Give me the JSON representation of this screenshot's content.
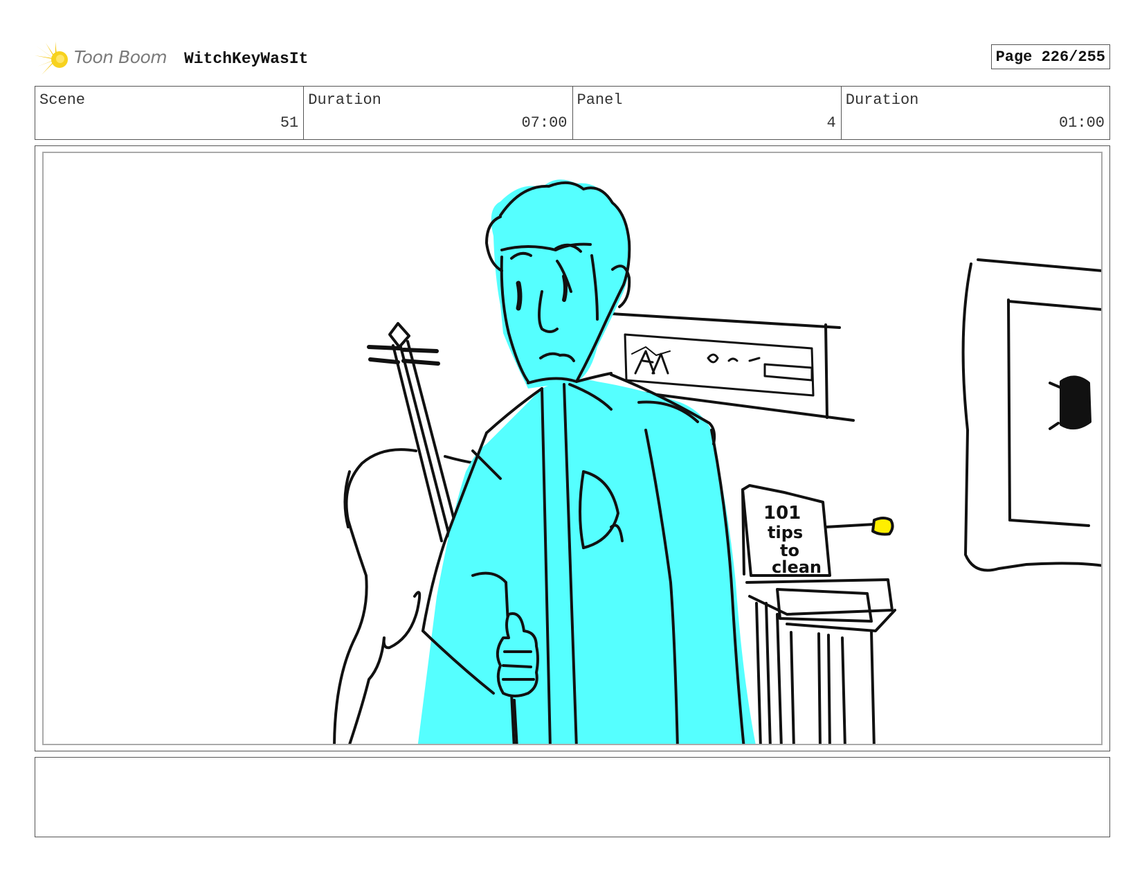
{
  "header": {
    "logo_text": "Toon Boom",
    "project_title": "WitchKeyWasIt",
    "page_label": "Page 226/255"
  },
  "info": {
    "scene_label": "Scene",
    "scene_value": "51",
    "scene_duration_label": "Duration",
    "scene_duration_value": "07:00",
    "panel_label": "Panel",
    "panel_value": "4",
    "panel_duration_label": "Duration",
    "panel_duration_value": "01:00"
  },
  "sketch": {
    "book_text": [
      "101",
      "tips",
      "to",
      "clean"
    ],
    "colors": {
      "character_fill": "#55ffff",
      "key_fill": "#ffee00",
      "ink": "#111111"
    }
  },
  "notes": {
    "text": ""
  }
}
